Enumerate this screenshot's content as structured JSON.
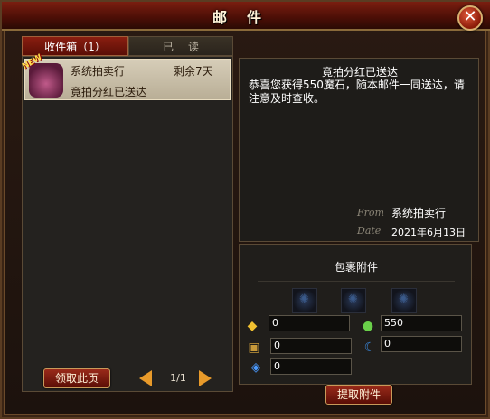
{
  "window": {
    "title": "邮件",
    "close_icon": "close-icon"
  },
  "tabs": [
    {
      "label": "收件箱（1）",
      "active": true
    },
    {
      "label": "已读",
      "active": false
    }
  ],
  "mail_list": [
    {
      "badge": "NEW",
      "sender": "系统拍卖行",
      "remaining": "剩余7天",
      "subject": "竟拍分红已送达",
      "icon": "bag-icon"
    }
  ],
  "footer": {
    "claim_page_label": "领取此页",
    "page_indicator": "1/1"
  },
  "mail_detail": {
    "title": "竟拍分红已送达",
    "body": "恭喜您获得550魔石，随本邮件一同送达，请注意及时查收。",
    "from_label": "From",
    "from_value": "系统拍卖行",
    "date_label": "Date",
    "date_value": "2021年6月13日"
  },
  "attachments": {
    "title": "包裹附件",
    "resources": [
      {
        "icon": "gold-icon",
        "value": "0"
      },
      {
        "icon": "magic-stone-icon",
        "value": "550"
      },
      {
        "icon": "ticket-icon",
        "value": "0"
      },
      {
        "icon": "moon-icon",
        "value": "0"
      },
      {
        "icon": "crystal-icon",
        "value": "0"
      }
    ],
    "claim_label": "提取附件"
  },
  "colors": {
    "title_bar": "#7a1e10",
    "accent_orange": "#e89a2a",
    "button_red": "#9a2a1a"
  }
}
